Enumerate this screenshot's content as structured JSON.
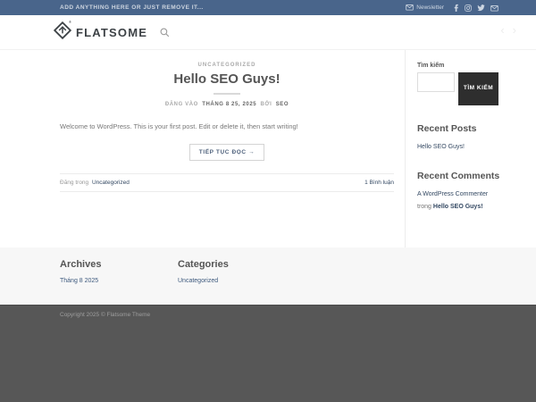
{
  "topbar": {
    "left_text": "ADD ANYTHING HERE OR JUST REMOVE IT...",
    "newsletter_label": "Newsletter",
    "icons": [
      "envelope-icon",
      "facebook-icon",
      "instagram-icon",
      "twitter-icon",
      "email-icon"
    ]
  },
  "header": {
    "logo_text": "FLATSOME",
    "logo_reg": "®",
    "search_icon": "magnifier-icon",
    "prev_arrow": "‹",
    "next_arrow": "›"
  },
  "post": {
    "category": "UNCATEGORIZED",
    "title": "Hello SEO Guys!",
    "meta_prefix": "ĐĂNG VÀO",
    "meta_date": "THÁNG 8 25, 2025",
    "meta_by": "BỞI",
    "meta_author": "SEO",
    "excerpt": "Welcome to WordPress. This is your first post. Edit or delete it, then start writing!",
    "read_more": "TIẾP TỤC ĐỌC →",
    "posted_in_prefix": "Đăng trong",
    "posted_in_category": "Uncategorized",
    "comments_link": "1 Bình luận"
  },
  "sidebar": {
    "search_label": "Tìm kiếm",
    "search_button": "TÌM KIẾM",
    "recent_posts_title": "Recent Posts",
    "recent_posts": [
      "Hello SEO Guys!"
    ],
    "recent_comments_title": "Recent Comments",
    "recent_comments": [
      {
        "author": "A WordPress Commenter",
        "in_word": "trong",
        "post": "Hello SEO Guys!"
      }
    ]
  },
  "footer": {
    "archives_title": "Archives",
    "archives_links": [
      "Tháng 8 2025"
    ],
    "categories_title": "Categories",
    "categories_links": [
      "Uncategorized"
    ],
    "copyright": "Copyright 2025 © Flatsome Theme"
  },
  "colors": {
    "topbar_bg": "#49658b",
    "link": "#334862",
    "heading": "#555555",
    "body_text": "#777777",
    "dark_button_bg": "#2e2e2e",
    "footer_widgets_bg": "#f7f7f7",
    "absolute_footer_bg": "#575757"
  }
}
